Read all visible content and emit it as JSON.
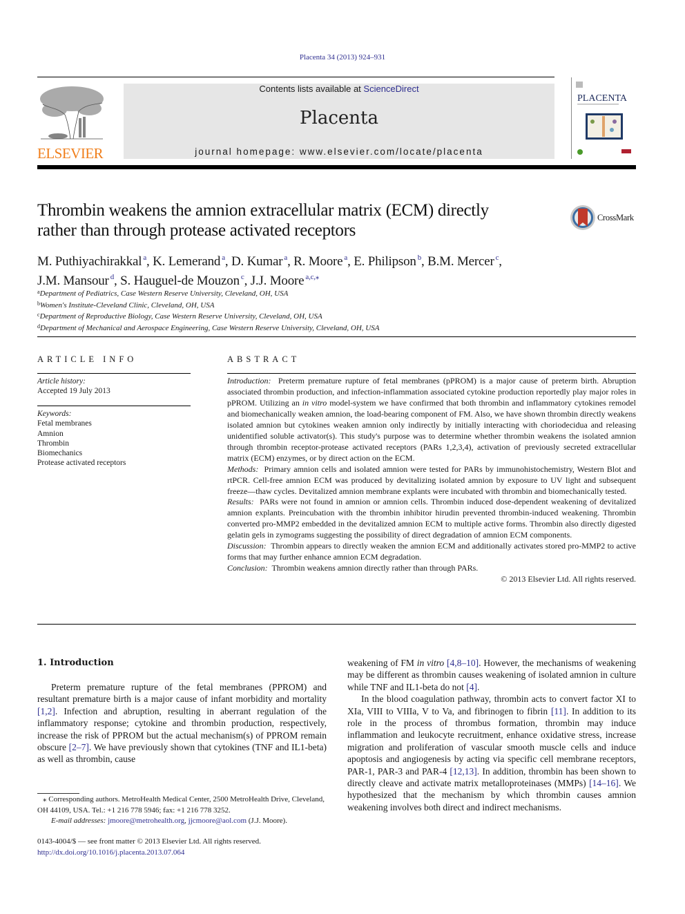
{
  "header": {
    "citation": "Placenta 34 (2013) 924–931",
    "contents_prefix": "Contents lists available at ",
    "contents_link": "ScienceDirect",
    "journal_name": "Placenta",
    "homepage": "journal homepage: www.elsevier.com/locate/placenta",
    "publisher_logo": "ELSEVIER",
    "cover_title": "PLACENTA",
    "link_color": "#2e2e8f",
    "publisher_color": "#f07f1c"
  },
  "article": {
    "title_line1": "Thrombin weakens the amnion extracellular matrix (ECM) directly",
    "title_line2": "rather than through protease activated receptors",
    "crossmark_label": "CrossMark",
    "authors_line1": [
      {
        "name": "M. Puthiyachirakkal",
        "sup": "a",
        "sep": ", "
      },
      {
        "name": "K. Lemerand",
        "sup": "a",
        "sep": ", "
      },
      {
        "name": "D. Kumar",
        "sup": "a",
        "sep": ", "
      },
      {
        "name": "R. Moore",
        "sup": "a",
        "sep": ", "
      },
      {
        "name": "E. Philipson",
        "sup": "b",
        "sep": ", "
      },
      {
        "name": "B.M. Mercer",
        "sup": "c",
        "sep": ","
      }
    ],
    "authors_line2": [
      {
        "name": "J.M. Mansour",
        "sup": "d",
        "sep": ", "
      },
      {
        "name": "S. Hauguel-de Mouzon",
        "sup": "c",
        "sep": ", "
      },
      {
        "name": "J.J. Moore",
        "sup": "a,c,⁎",
        "sep": ""
      }
    ],
    "affiliations": [
      {
        "key": "a",
        "text": "Department of Pediatrics, Case Western Reserve University, Cleveland, OH, USA"
      },
      {
        "key": "b",
        "text": "Women's Institute-Cleveland Clinic, Cleveland, OH, USA"
      },
      {
        "key": "c",
        "text": "Department of Reproductive Biology, Case Western Reserve University, Cleveland, OH, USA"
      },
      {
        "key": "d",
        "text": "Department of Mechanical and Aerospace Engineering, Case Western Reserve University, Cleveland, OH, USA"
      }
    ]
  },
  "article_info": {
    "heading": "ARTICLE INFO",
    "history_label": "Article history:",
    "accepted": "Accepted 19 July 2013",
    "keywords_label": "Keywords:",
    "keywords": [
      "Fetal membranes",
      "Amnion",
      "Thrombin",
      "Biomechanics",
      "Protease activated receptors"
    ]
  },
  "abstract": {
    "heading": "ABSTRACT",
    "sections": [
      {
        "label": "Introduction:",
        "text_before": "Preterm premature rupture of fetal membranes (pPROM) is a major cause of preterm birth. Abruption associated thrombin production, and infection-inflammation associated cytokine production reportedly play major roles in pPROM. Utilizing an ",
        "italic": "in vitro",
        "text_after": " model-system we have confirmed that both thrombin and inflammatory cytokines remodel and biomechanically weaken amnion, the load-bearing component of FM. Also, we have shown thrombin directly weakens isolated amnion but cytokines weaken amnion only indirectly by initially interacting with choriodecidua and releasing unidentified soluble activator(s). This study's purpose was to determine whether thrombin weakens the isolated amnion through thrombin receptor-protease activated receptors (PARs 1,2,3,4), activation of previously secreted extracellular matrix (ECM) enzymes, or by direct action on the ECM."
      },
      {
        "label": "Methods:",
        "text_before": "Primary amnion cells and isolated amnion were tested for PARs by immunohistochemistry, Western Blot and rtPCR. Cell-free amnion ECM was produced by devitalizing isolated amnion by exposure to UV light and subsequent freeze—thaw cycles. Devitalized amnion membrane explants were incubated with thrombin and biomechanically tested.",
        "italic": "",
        "text_after": ""
      },
      {
        "label": "Results:",
        "text_before": "PARs were not found in amnion or amnion cells. Thrombin induced dose-dependent weakening of devitalized amnion explants. Preincubation with the thrombin inhibitor hirudin prevented thrombin-induced weakening. Thrombin converted pro-MMP2 embedded in the devitalized amnion ECM to multiple active forms. Thrombin also directly digested gelatin gels in zymograms suggesting the possibility of direct degradation of amnion ECM components.",
        "italic": "",
        "text_after": ""
      },
      {
        "label": "Discussion:",
        "text_before": "Thrombin appears to directly weaken the amnion ECM and additionally activates stored pro-MMP2 to active forms that may further enhance amnion ECM degradation.",
        "italic": "",
        "text_after": ""
      },
      {
        "label": "Conclusion:",
        "text_before": "Thrombin weakens amnion directly rather than through PARs.",
        "italic": "",
        "text_after": ""
      }
    ],
    "copyright": "© 2013 Elsevier Ltd. All rights reserved."
  },
  "body": {
    "section_heading": "1.  Introduction",
    "left_para": [
      {
        "t": "Preterm premature rupture of the fetal membranes (PPROM) and resultant premature birth is a major cause of infant morbidity and mortality "
      },
      {
        "ref": "[1,2]"
      },
      {
        "t": ". Infection and abruption, resulting in aberrant regulation of the inflammatory response; cytokine and thrombin production, respectively, increase the risk of PPROM but the actual mechanism(s) of PPROM remain obscure "
      },
      {
        "ref": "[2–7]"
      },
      {
        "t": ". We have previously shown that cytokines (TNF and IL1-beta) as well as thrombin, cause"
      }
    ],
    "right_para1": [
      {
        "t": "weakening of FM "
      },
      {
        "i": "in vitro"
      },
      {
        "t": " "
      },
      {
        "ref": "[4,8–10]"
      },
      {
        "t": ". However, the mechanisms of weakening may be different as thrombin causes weakening of isolated amnion in culture while TNF and IL1-beta do not "
      },
      {
        "ref": "[4]"
      },
      {
        "t": "."
      }
    ],
    "right_para2": [
      {
        "t": "In the blood coagulation pathway, thrombin acts to convert factor XI to XIa, VIII to VIIIa, V to Va, and fibrinogen to fibrin "
      },
      {
        "ref": "[11]"
      },
      {
        "t": ". In addition to its role in the process of thrombus formation, thrombin may induce inflammation and leukocyte recruitment, enhance oxidative stress, increase migration and proliferation of vascular smooth muscle cells and induce apoptosis and angiogenesis by acting via specific cell membrane receptors, PAR-1, PAR-3 and PAR-4 "
      },
      {
        "ref": "[12,13]"
      },
      {
        "t": ". In addition, thrombin has been shown to directly cleave and activate matrix metalloproteinases (MMPs) "
      },
      {
        "ref": "[14–16]"
      },
      {
        "t": ". We hypothesized that the mechanism by which thrombin causes amnion weakening involves both direct and indirect mechanisms."
      }
    ]
  },
  "footnotes": {
    "corresponding": "⁎ Corresponding authors. MetroHealth Medical Center, 2500 MetroHealth Drive, Cleveland, OH 44109, USA. Tel.: +1 216 778 5946; fax: +1 216 778 3252.",
    "email_label": "E-mail addresses:",
    "email1": "jmoore@metrohealth.org",
    "email2": "jjcmoore@aol.com",
    "email_owner": "(J.J. Moore).",
    "front_matter": "0143-4004/$ — see front matter © 2013 Elsevier Ltd. All rights reserved.",
    "doi": "http://dx.doi.org/10.1016/j.placenta.2013.07.064"
  }
}
